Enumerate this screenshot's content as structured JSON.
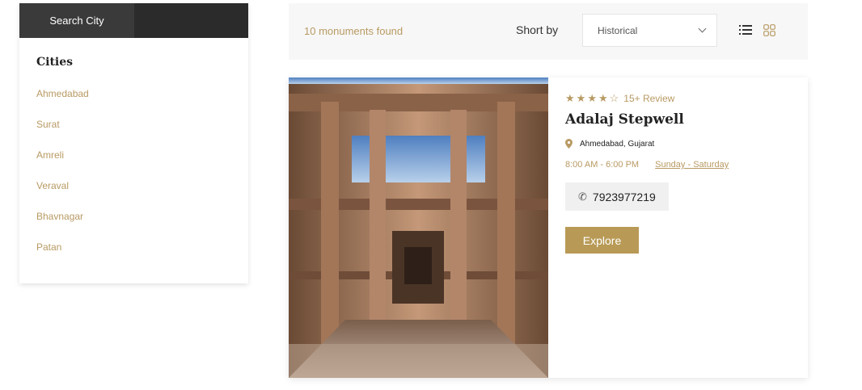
{
  "sidebar": {
    "search_label": "Search City",
    "cities_title": "Cities",
    "cities": [
      "Ahmedabad",
      "Surat",
      "Amreli",
      "Veraval",
      "Bhavnagar",
      "Patan"
    ]
  },
  "toolbar": {
    "count_text": "10 monuments found",
    "sort_label": "Short by",
    "sort_value": "Historical",
    "list_view_icon": "list-icon",
    "grid_view_icon": "grid-icon"
  },
  "card": {
    "image_icon": "stepwell-photo",
    "rating": {
      "filled_stars": 4,
      "total_stars": 5,
      "review_text": "15+ Review"
    },
    "title": "Adalaj Stepwell",
    "location": "Ahmedabad, Gujarat",
    "hours": "8:00 AM - 6:00 PM",
    "days": "Sunday - Saturday",
    "phone": "7923977219",
    "explore_label": "Explore"
  },
  "colors": {
    "accent": "#b89a63",
    "button": "#b89a56",
    "search_bg": "#2b2b2b"
  }
}
